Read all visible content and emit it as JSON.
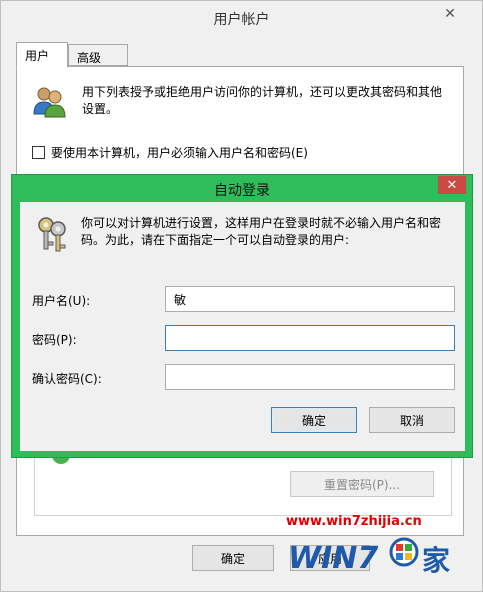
{
  "outer_window": {
    "title": "用户帐户",
    "close_glyph": "✕",
    "tabs": [
      {
        "label": "用户",
        "active": true
      },
      {
        "label": "高级",
        "active": false
      }
    ],
    "description": "用下列表授予或拒绝用户访问你的计算机，还可以更改其密码和其他设置。",
    "must_login_label": "要使用本计算机，用户必须输入用户名和密码(E)",
    "must_login_checked": false,
    "reset_password_label": "重置密码(P)...",
    "ok_label": "确定",
    "apply_label": "应用"
  },
  "dialog": {
    "title": "自动登录",
    "close_glyph": "✕",
    "description": "你可以对计算机进行设置，这样用户在登录时就不必输入用户名和密码。为此，请在下面指定一个可以自动登录的用户:",
    "username_label": "用户名(U):",
    "username_value": "敏",
    "password_label": "密码(P):",
    "password_value": "",
    "confirm_label": "确认密码(C):",
    "confirm_value": "",
    "ok_label": "确定",
    "cancel_label": "取消"
  },
  "watermark": {
    "url": "www.win7zhijia.cn",
    "logo_text": "WIN7",
    "logo_suffix": "家"
  },
  "colors": {
    "dialog_frame": "#2fbd5c",
    "close_red": "#c94a42",
    "focus_blue": "#3c7fb1",
    "watermark_red": "#e00000"
  }
}
